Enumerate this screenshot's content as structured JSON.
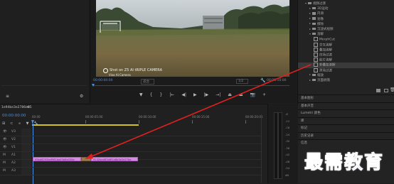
{
  "program_monitor": {
    "timecode_current": "00:00:00:00",
    "fit_option": "适合",
    "scale": "1/2",
    "timecode_total": "00:00:10:00",
    "video_watermark_line1": "Shot on Z5 AI tRIPLE CAMERA",
    "video_watermark_line2": "Vivo AI Camera"
  },
  "effects_panel": {
    "items": [
      {
        "label": "视频过渡",
        "indent": 0,
        "kind": "folder",
        "expanded": true
      },
      {
        "label": "3D运动",
        "indent": 1,
        "kind": "folder"
      },
      {
        "label": "内滑",
        "indent": 1,
        "kind": "folder"
      },
      {
        "label": "划像",
        "indent": 1,
        "kind": "folder"
      },
      {
        "label": "擦除",
        "indent": 1,
        "kind": "folder"
      },
      {
        "label": "沉浸式视频",
        "indent": 1,
        "kind": "folder"
      },
      {
        "label": "溶解",
        "indent": 1,
        "kind": "folder",
        "expanded": true
      },
      {
        "label": "MorphCut",
        "indent": 2,
        "kind": "effect"
      },
      {
        "label": "交叉溶解",
        "indent": 2,
        "kind": "effect"
      },
      {
        "label": "叠加溶解",
        "indent": 2,
        "kind": "effect"
      },
      {
        "label": "白场过渡",
        "indent": 2,
        "kind": "effect"
      },
      {
        "label": "胶片溶解",
        "indent": 2,
        "kind": "effect"
      },
      {
        "label": "非叠加溶解",
        "indent": 2,
        "kind": "effect",
        "selected": true
      },
      {
        "label": "黑场过渡",
        "indent": 2,
        "kind": "effect"
      },
      {
        "label": "缩放",
        "indent": 1,
        "kind": "folder"
      },
      {
        "label": "页面剥落",
        "indent": 1,
        "kind": "folder"
      }
    ],
    "sections": [
      "基本图形",
      "基本声音",
      "Lumetri 颜色",
      "库",
      "标记",
      "历史记录",
      "信息"
    ]
  },
  "timeline": {
    "sequence_name": "1e94be3e2786e65",
    "timecode": "00:00:00:00",
    "ruler_labels": [
      "00:00",
      "00:00:05:00",
      "00:00:10:00",
      "00:00:15:00",
      "00:00:20:00"
    ],
    "track_labels": [
      "V3",
      "V2",
      "V1",
      "A1",
      "A2",
      "A3"
    ],
    "clips": [
      {
        "label": "93ed6292bef961ba40b8e034e",
        "track": "V1"
      },
      {
        "label": "9132bad81b6f1a8b3e2e27be",
        "track": "V1"
      }
    ],
    "meter_labels": [
      "-6",
      "-12",
      "-18",
      "-24",
      "-30",
      "-36",
      "-42",
      "-48",
      "-54",
      "dB"
    ]
  },
  "watermark_text": "最需教育",
  "colors": {
    "accent_blue": "#4f8fdc",
    "clip_pink": "#d58ce0",
    "arrow_red": "#e02020",
    "playhead_blue": "#4a90e2",
    "work_area_yellow": "#d2c21e"
  }
}
